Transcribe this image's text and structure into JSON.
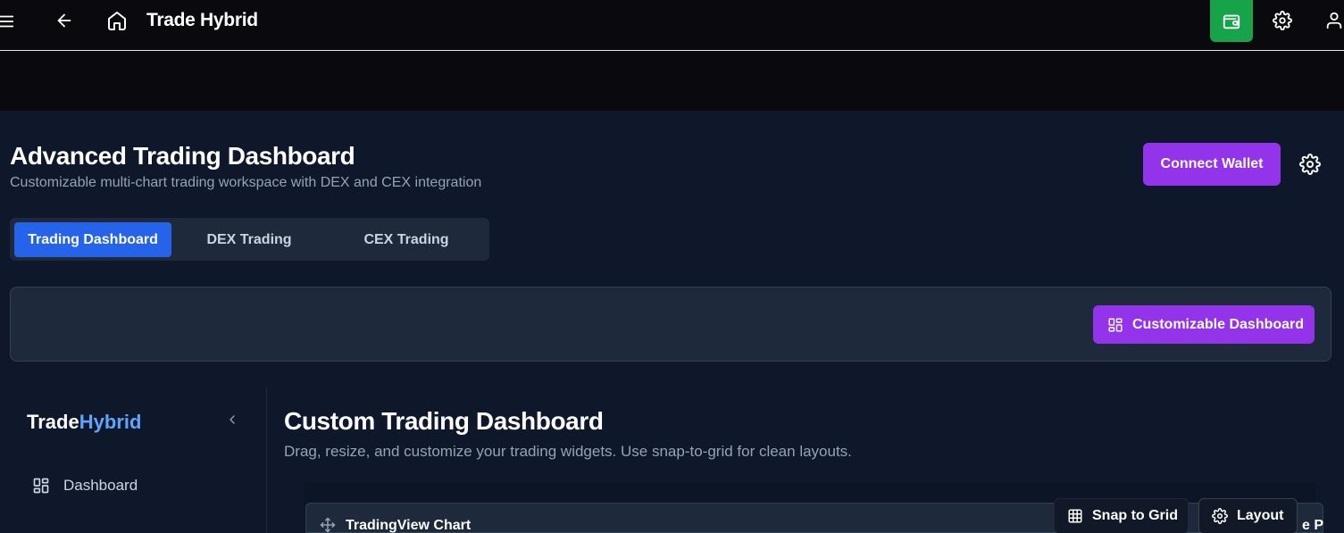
{
  "header": {
    "title": "Trade Hybrid",
    "menu_icon": "menu-icon",
    "back_icon": "arrow-left-icon",
    "home_icon": "home-icon",
    "wallet_icon": "wallet-icon",
    "settings_icon": "gear-icon",
    "user_icon": "user-icon",
    "wallet_color": "#16a34a"
  },
  "page": {
    "title": "Advanced Trading Dashboard",
    "subtitle": "Customizable multi-chart trading workspace with DEX and CEX integration",
    "connect_wallet_label": "Connect Wallet",
    "accent_color": "#9333ea"
  },
  "tabs": [
    {
      "label": "Trading Dashboard",
      "active": true
    },
    {
      "label": "DEX Trading",
      "active": false
    },
    {
      "label": "CEX Trading",
      "active": false
    }
  ],
  "toolbar": {
    "customizable_label": "Customizable Dashboard"
  },
  "sidebar": {
    "brand_part1": "Trade",
    "brand_part2": "Hybrid",
    "items": [
      {
        "label": "Dashboard",
        "icon": "dashboard-grid-icon"
      }
    ]
  },
  "content": {
    "title": "Custom Trading Dashboard",
    "subtitle": "Drag, resize, and customize your trading widgets. Use snap-to-grid for clean layouts.",
    "snap_label": "Snap to Grid",
    "layout_label": "Layout",
    "widget_title": "TradingView Chart",
    "clipped_text": "e P"
  }
}
